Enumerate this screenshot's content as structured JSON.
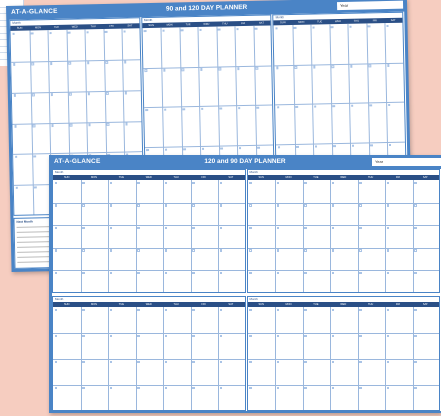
{
  "back_planner": {
    "brand": "AT-A-GLANCE",
    "title": "90 and 120 DAY PLANNER",
    "year_label": "Year",
    "month_label": "Month",
    "days": [
      "SUN",
      "MON",
      "TUE",
      "WED",
      "THU",
      "FRI",
      "SAT"
    ],
    "notes_label": "Next Month"
  },
  "front_planner": {
    "brand": "AT-A-GLANCE",
    "title": "120 and 90 DAY PLANNER",
    "year_label": "Year",
    "month_label": "Month",
    "days": [
      "SUN",
      "MON",
      "TUE",
      "WED",
      "THU",
      "FRI",
      "SAT"
    ]
  },
  "colors": {
    "background": "#f6cdc0",
    "frame": "#4a84c6",
    "header_band": "#2a4f86",
    "grid_line": "#9ab7dd"
  }
}
